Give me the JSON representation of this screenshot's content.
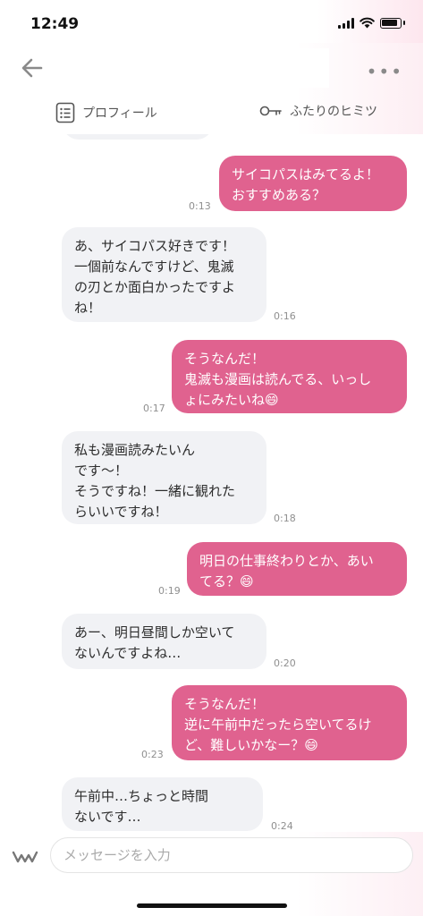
{
  "status_bar": {
    "time": "12:49"
  },
  "header": {
    "tabs": [
      {
        "label": "プロフィール",
        "icon": "profile-list-icon"
      },
      {
        "label": "ふたりのヒミツ",
        "icon": "key-icon"
      }
    ]
  },
  "messages": [
    {
      "side": "mine",
      "text": "サイコパスはみてるよ！\nおすすめある？",
      "time": "0:13"
    },
    {
      "side": "theirs",
      "text": "あ、サイコパス好きです！\n一個前なんですけど、鬼滅\nの刃とか面白かったですよ\nね！",
      "time": "0:16"
    },
    {
      "side": "mine",
      "text": "そうなんだ！\n鬼滅も漫画は読んでる、いっし\nょにみたいね😄",
      "time": "0:17"
    },
    {
      "side": "theirs",
      "text": "私も漫画読みたいん\nです〜！\nそうですね！一緒に観れた\nらいいですね！",
      "time": "0:18"
    },
    {
      "side": "mine",
      "text": "明日の仕事終わりとか、あい\nてる？😄",
      "time": "0:19"
    },
    {
      "side": "theirs",
      "text": "あー、明日昼間しか空いて\nないんですよね…",
      "time": "0:20"
    },
    {
      "side": "mine",
      "text": "そうなんだ！\n逆に午前中だったら空いてるけ\nど、難しいかなー？😄",
      "time": "0:23"
    },
    {
      "side": "theirs",
      "text": "午前中…ちょっと時間\nないです…",
      "time": "0:24"
    }
  ],
  "composer": {
    "placeholder": "メッセージを入力"
  },
  "colors": {
    "mine_bubble": "#e0628f",
    "theirs_bubble": "#f1f2f5"
  }
}
